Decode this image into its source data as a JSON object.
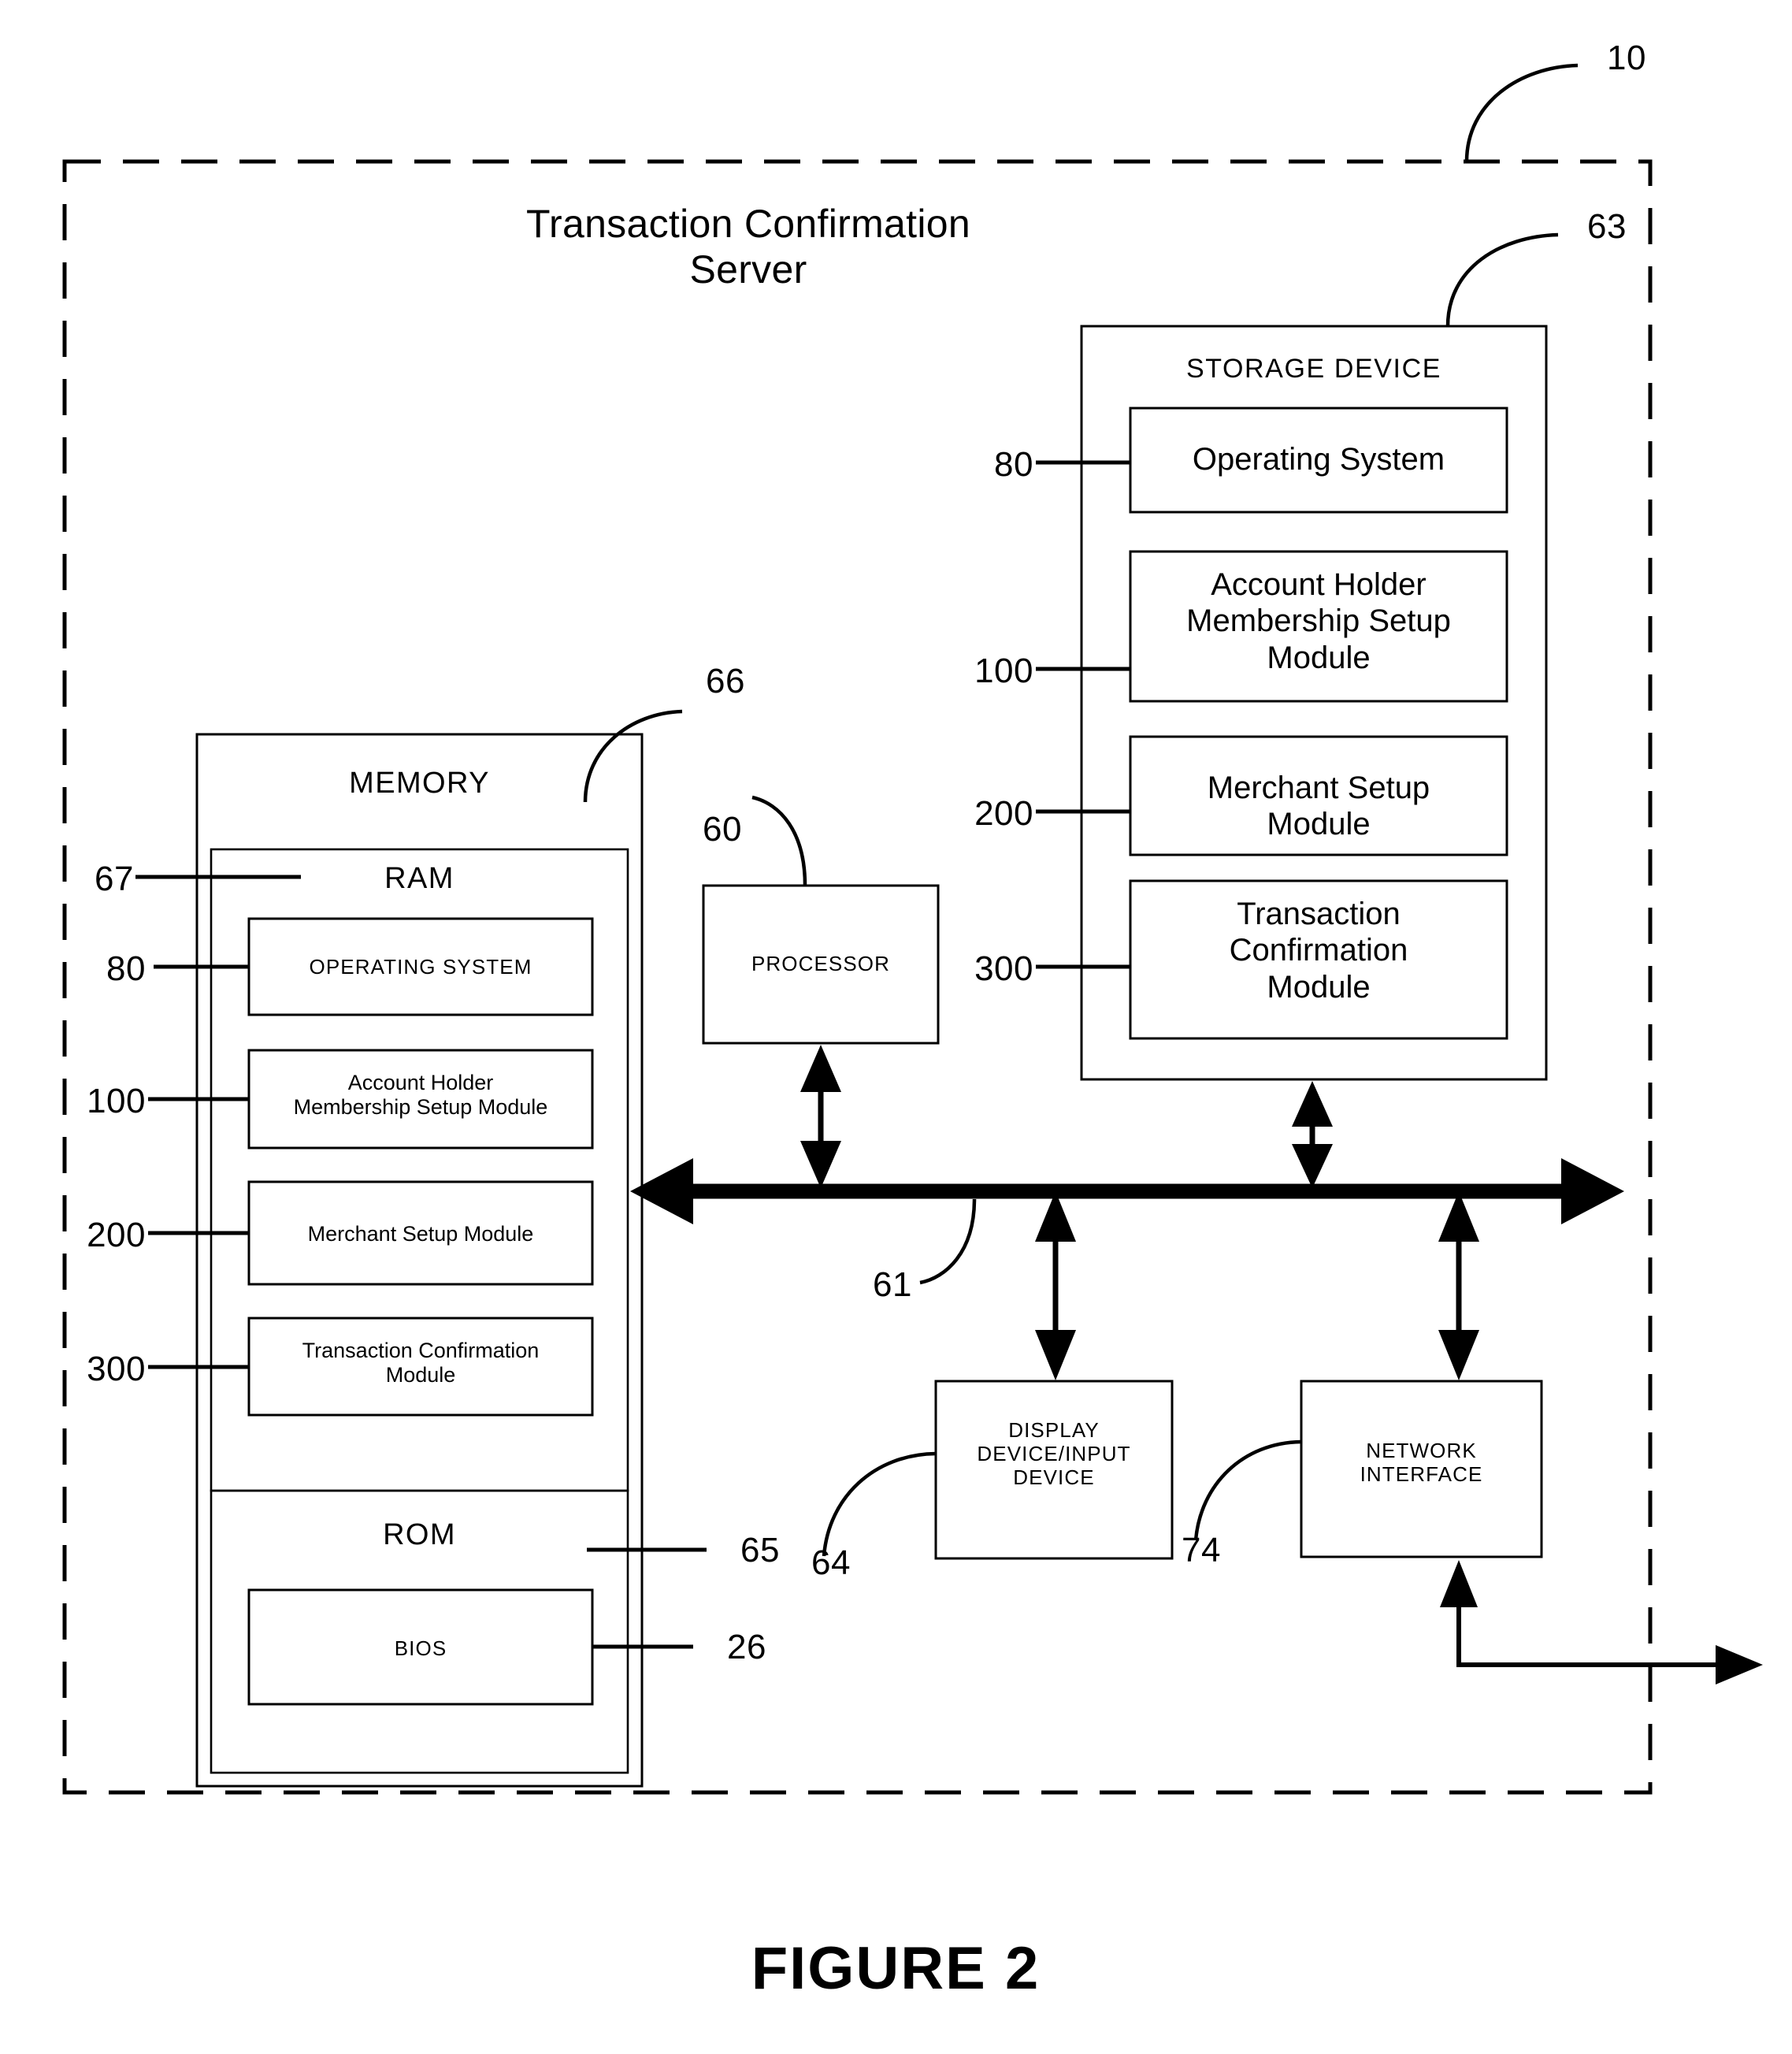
{
  "figure": {
    "caption": "FIGURE 2",
    "system_title": "Transaction Confirmation\nServer",
    "system_ref": "10"
  },
  "storage_device": {
    "title": "STORAGE DEVICE",
    "ref": "63",
    "modules": [
      {
        "label": "Operating System",
        "ref": "80"
      },
      {
        "label": "Account Holder\nMembership Setup\nModule",
        "ref": "100"
      },
      {
        "label": "Merchant Setup\nModule",
        "ref": "200"
      },
      {
        "label": "Transaction\nConfirmation\nModule",
        "ref": "300"
      }
    ]
  },
  "memory": {
    "title": "MEMORY",
    "ref": "66",
    "ram": {
      "title": "RAM",
      "ref": "67",
      "modules": [
        {
          "label": "OPERATING SYSTEM",
          "ref": "80"
        },
        {
          "label": "Account Holder\nMembership Setup Module",
          "ref": "100"
        },
        {
          "label": "Merchant Setup Module",
          "ref": "200"
        },
        {
          "label": "Transaction Confirmation\nModule",
          "ref": "300"
        }
      ]
    },
    "rom": {
      "title": "ROM",
      "ref": "65",
      "modules": [
        {
          "label": "BIOS",
          "ref": "26"
        }
      ]
    }
  },
  "processor": {
    "label": "PROCESSOR",
    "ref": "60"
  },
  "bus": {
    "ref": "61"
  },
  "display_device": {
    "label": "DISPLAY\nDEVICE/INPUT\nDEVICE",
    "ref": "64"
  },
  "network_interface": {
    "label": "NETWORK\nINTERFACE",
    "ref": "74"
  }
}
